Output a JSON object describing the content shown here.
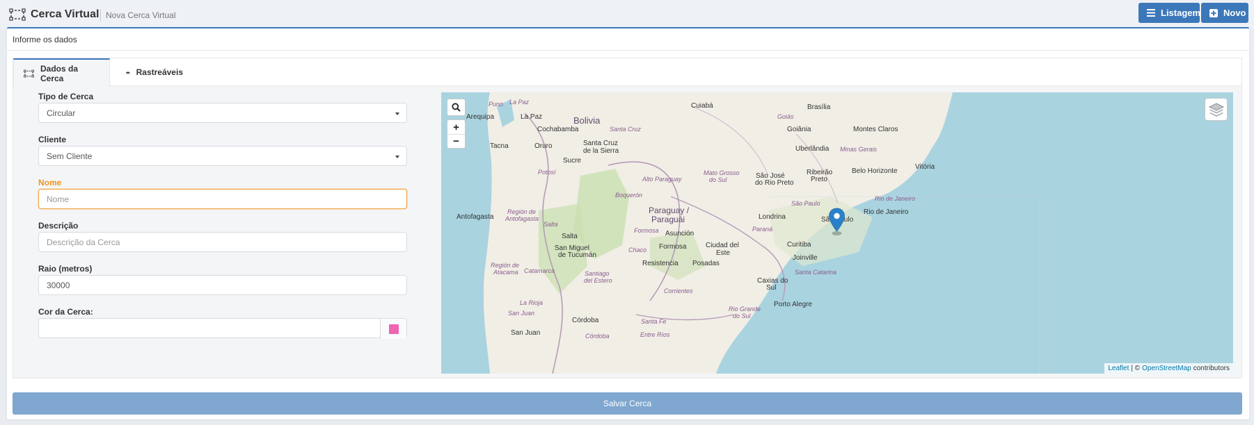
{
  "header": {
    "title": "Cerca Virtual",
    "subtitle": "Nova Cerca Virtual",
    "buttons": {
      "listagem": "Listagem",
      "novo": "Novo"
    }
  },
  "panel": {
    "header_label": "Informe os dados"
  },
  "tabs": [
    {
      "label": "Dados da Cerca",
      "icon": "fence-icon",
      "active": true
    },
    {
      "label": "Rastreáveis",
      "icon": "car-icon",
      "active": false
    }
  ],
  "form": {
    "tipo": {
      "label": "Tipo de Cerca",
      "value": "Circular"
    },
    "cliente": {
      "label": "Cliente",
      "value": "Sem Cliente"
    },
    "nome": {
      "label": "Nome",
      "value": "",
      "placeholder": "Nome"
    },
    "descricao": {
      "label": "Descrição",
      "value": "",
      "placeholder": "Descrição da Cerca"
    },
    "raio": {
      "label": "Raio (metros)",
      "value": "30000"
    },
    "cor": {
      "label": "Cor da Cerca:",
      "value": "",
      "swatch": "#f064b4"
    }
  },
  "map": {
    "zoom_in": "+",
    "zoom_out": "−",
    "labels": {
      "puno": "Puno",
      "la_paz_region": "La Paz",
      "bolivia": "Bolivia",
      "cuiaba": "Cuiabá",
      "brasilia": "Brasília",
      "arequipa": "Arequipa",
      "la_paz": "La Paz",
      "goias": "Goiás",
      "cochabamba": "Cochabamba",
      "santa_cruz_region": "Santa Cruz",
      "goiania": "Goiânia",
      "montes_claros": "Montes Claros",
      "tacna": "Tacna",
      "oruro": "Oruro",
      "santa_cruz": "Santa Cruz",
      "de_la_sierra": "de la Sierra",
      "uberlandia": "Uberlândia",
      "minas_gerais": "Minas Gerais",
      "sucre": "Sucre",
      "potosi": "Potosí",
      "mato_grosso": "Mato Grosso",
      "do_sul": "do Sul",
      "sao_jose": "São José",
      "do_rio_preto": "do Rio Preto",
      "ribeirao": "Ribeirão",
      "preto": "Preto",
      "belo_horizonte": "Belo Horizonte",
      "vitoria": "Vitória",
      "alto_paraguay": "Alto Paraguay",
      "boqueron": "Boquerón",
      "paraguay": "Paraguay /",
      "paraguai": "Paraguái",
      "sao_paulo_region": "São Paulo",
      "rio_de_janeiro_region": "Rio de Janeiro",
      "antofagasta": "Antofagasta",
      "region_de": "Región de",
      "antofagasta_region": "Antofagasta",
      "salta_region": "Salta",
      "londrina": "Londrina",
      "sao_paulo": "São Paulo",
      "rio_de_janeiro": "Rio de Janeiro",
      "salta": "Salta",
      "formosa_region": "Formosa",
      "asuncion": "Asunción",
      "parana": "Paraná",
      "san_miguel": "San Miguel",
      "de_tucuman": "de Tucumán",
      "chaco": "Chaco",
      "formosa": "Formosa",
      "ciudad_del": "Ciudad del",
      "este": "Este",
      "curitiba": "Curitiba",
      "joinville": "Joinville",
      "resistencia": "Resistencia",
      "posadas": "Posadas",
      "santa_catarina": "Santa Catarina",
      "region_de_2": "Región de",
      "atacama": "Atacama",
      "catamarca": "Catamarca",
      "santiago": "Santiago",
      "del_estero": "del Estero",
      "caxias_do": "Caxias do",
      "sul": "Sul",
      "corrientes": "Corrientes",
      "la_rioja": "La Rioja",
      "porto_alegre": "Porto Alegre",
      "rio_grande": "Rio Grande",
      "do_sul_2": "do Sul",
      "san_juan_region": "San Juan",
      "cordoba": "Córdoba",
      "santa_fe": "Santa Fe",
      "san_juan": "San Juan",
      "entre_rios": "Entre Ríos",
      "cordoba_region": "Córdoba"
    },
    "attribution": {
      "leaflet": "Leaflet",
      "separator": "| ©",
      "osm": "OpenStreetMap",
      "contributors": "contributors"
    }
  },
  "save_button": "Salvar Cerca",
  "colors": {
    "primary": "#3c78b9",
    "accent_orange": "#f0931e",
    "save_disabled": "#7fa7cf",
    "map_water": "#a9d3df",
    "map_land": "#f1eee6",
    "map_green": "#c9e0b0",
    "marker": "#2a81cb"
  }
}
